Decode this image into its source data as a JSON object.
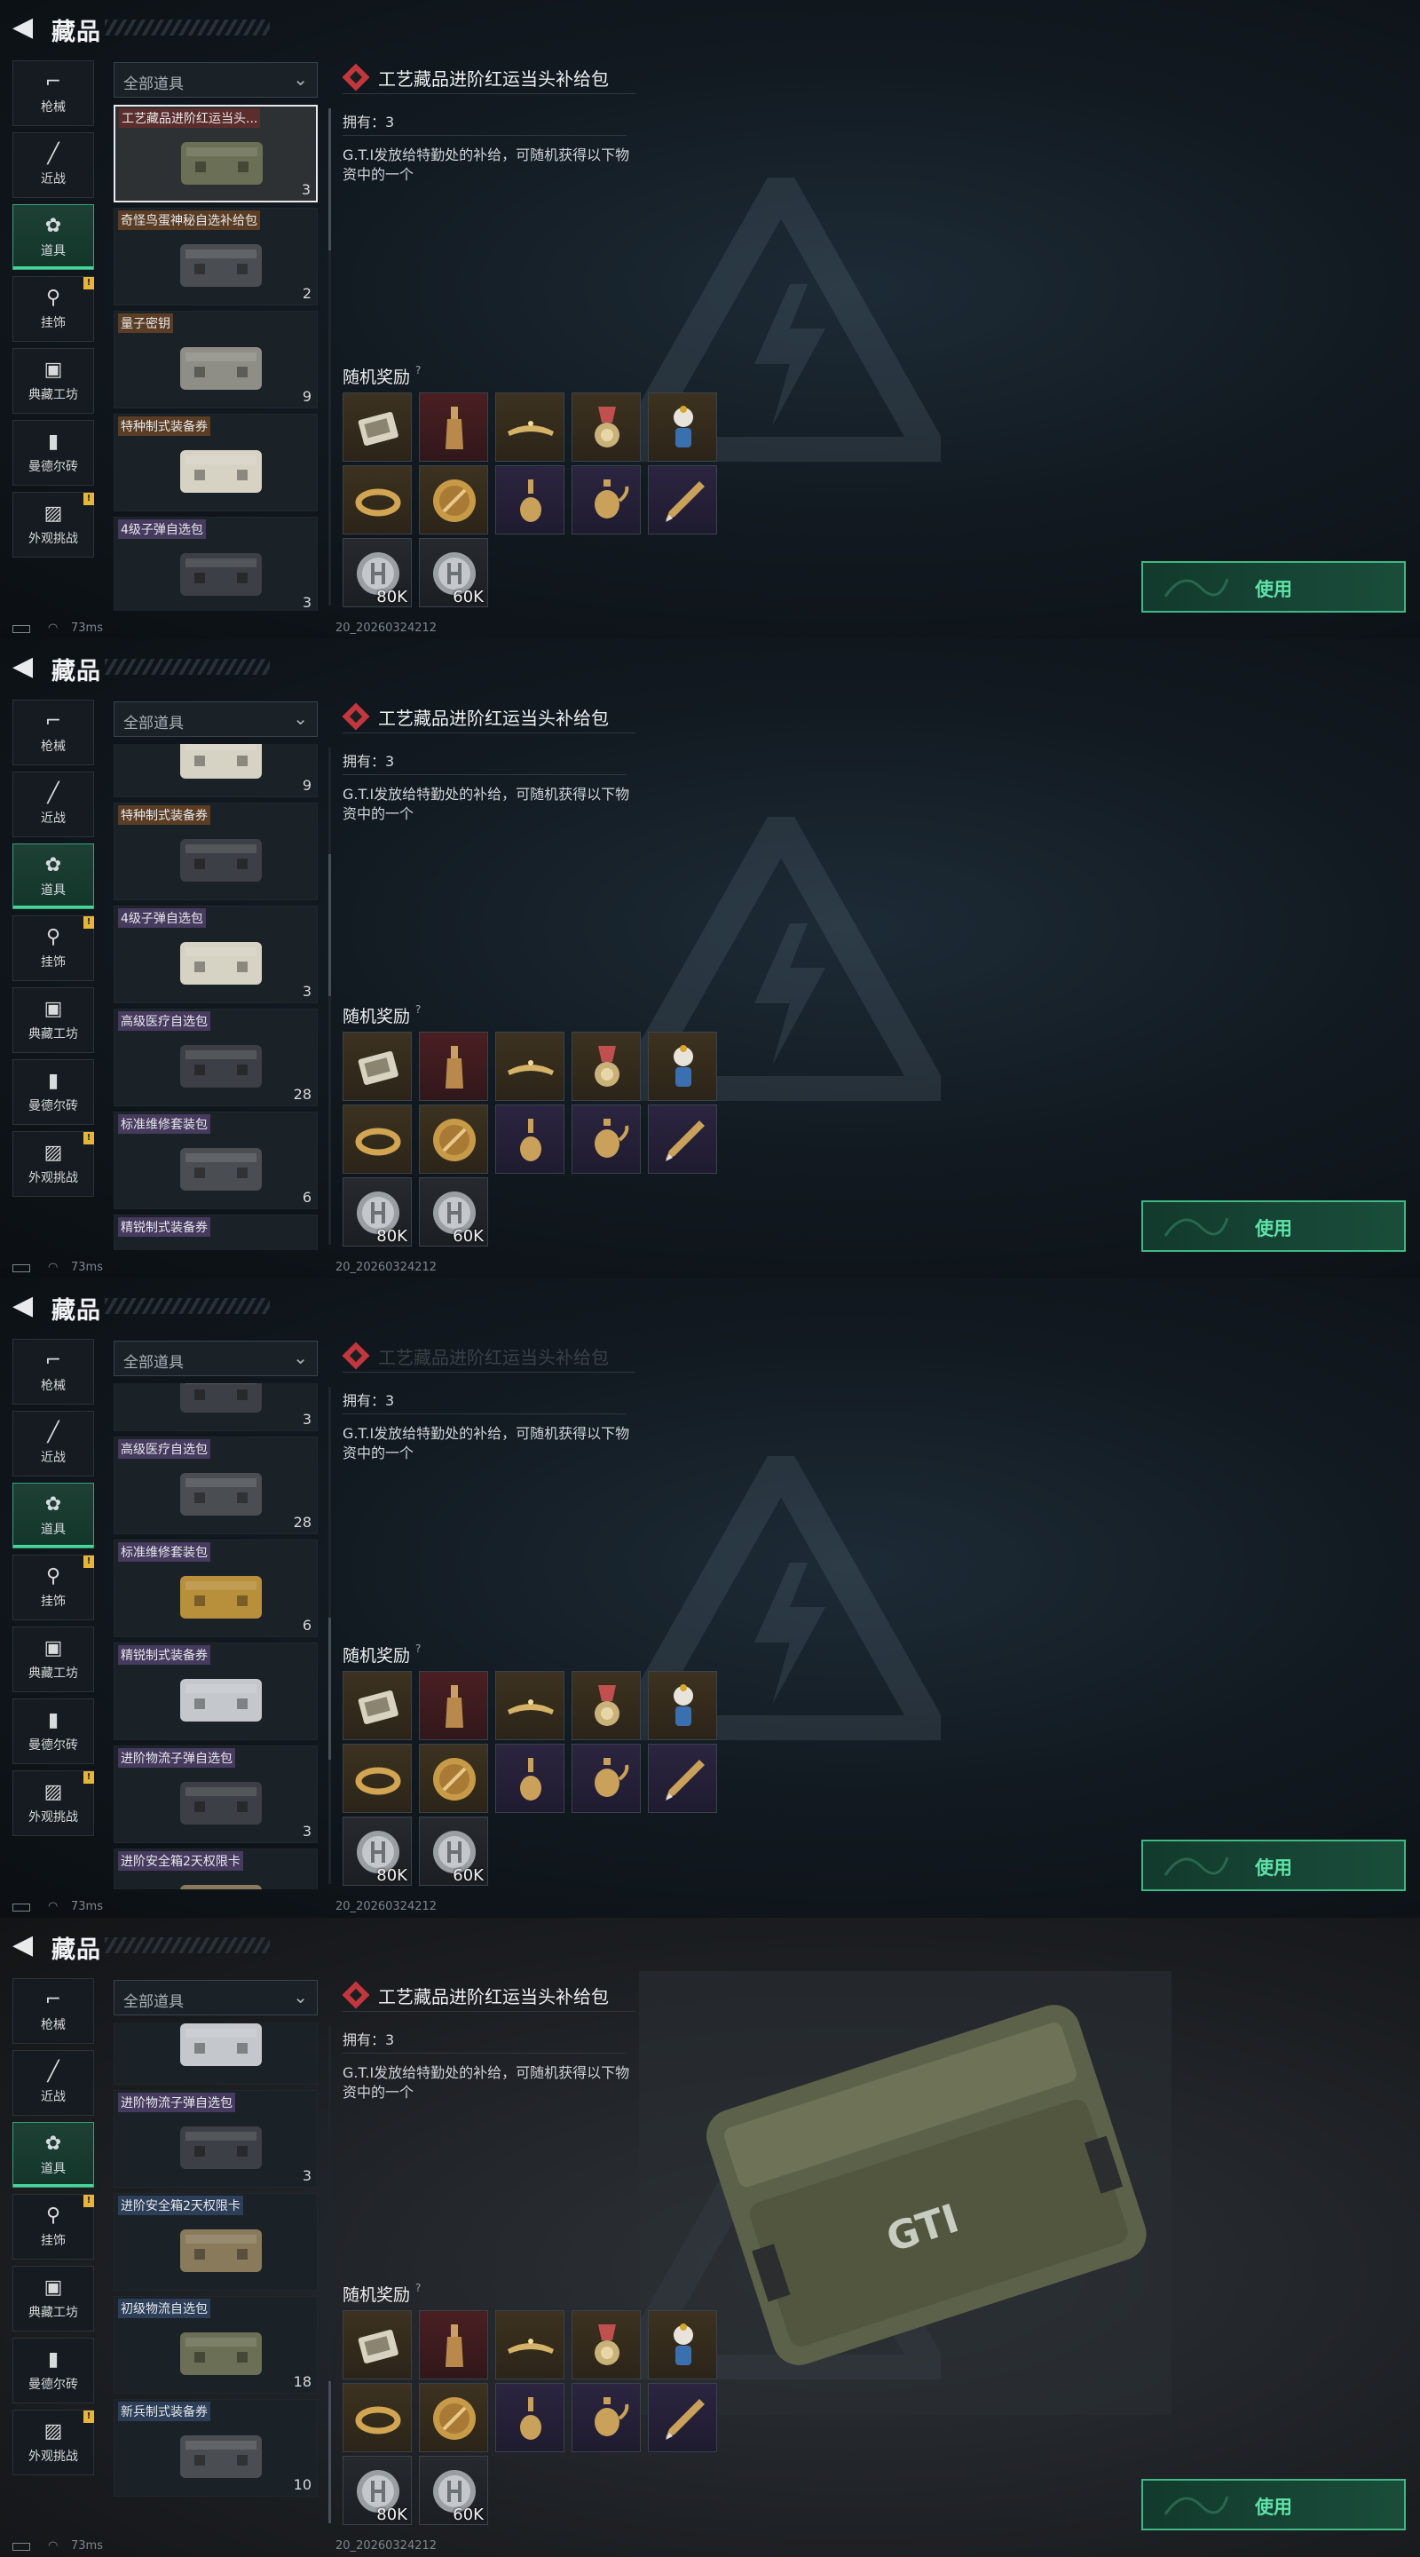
{
  "header": {
    "title": "藏品",
    "back_icon": "back-arrow-icon"
  },
  "categories": [
    {
      "label": "枪械",
      "icon": "gun-icon",
      "badge": ""
    },
    {
      "label": "近战",
      "icon": "knife-icon",
      "badge": ""
    },
    {
      "label": "道具",
      "icon": "items-icon",
      "badge": "",
      "active": true
    },
    {
      "label": "挂饰",
      "icon": "charm-icon",
      "badge": "!"
    },
    {
      "label": "典藏工坊",
      "icon": "workshop-icon",
      "badge": ""
    },
    {
      "label": "曼德尔砖",
      "icon": "mandel-brick-icon",
      "badge": ""
    },
    {
      "label": "外观挑战",
      "icon": "challenge-icon",
      "badge": "!"
    }
  ],
  "filter": {
    "label": "全部道具",
    "icon": "chevron-down-icon"
  },
  "screens": [
    {
      "items": [
        {
          "name": "工艺藏品进阶红运当头...",
          "qty": "3",
          "color": "red",
          "selected": true
        },
        {
          "name": "奇怪鸟蛋神秘自选补给包",
          "qty": "2",
          "color": "org"
        },
        {
          "name": "量子密钥",
          "qty": "9",
          "color": "org"
        },
        {
          "name": "特种制式装备券",
          "qty": "",
          "color": "org"
        },
        {
          "name": "4级子弹自选包",
          "qty": "3",
          "color": "pur"
        }
      ]
    },
    {
      "items": [
        {
          "name": "",
          "qty": "9",
          "color": ""
        },
        {
          "name": "特种制式装备券",
          "qty": "",
          "color": "org"
        },
        {
          "name": "4级子弹自选包",
          "qty": "3",
          "color": "pur"
        },
        {
          "name": "高级医疗自选包",
          "qty": "28",
          "color": "pur"
        },
        {
          "name": "标准维修套装包",
          "qty": "6",
          "color": "pur"
        },
        {
          "name": "精锐制式装备券",
          "qty": "",
          "color": "pur"
        }
      ]
    },
    {
      "items": [
        {
          "name": "",
          "qty": "3",
          "color": ""
        },
        {
          "name": "高级医疗自选包",
          "qty": "28",
          "color": "pur"
        },
        {
          "name": "标准维修套装包",
          "qty": "6",
          "color": "pur"
        },
        {
          "name": "精锐制式装备券",
          "qty": "",
          "color": "pur"
        },
        {
          "name": "进阶物流子弹自选包",
          "qty": "3",
          "color": "pur"
        },
        {
          "name": "进阶安全箱2天权限卡",
          "qty": "",
          "color": "pur"
        }
      ]
    },
    {
      "items": [
        {
          "name": "",
          "qty": "",
          "color": ""
        },
        {
          "name": "进阶物流子弹自选包",
          "qty": "3",
          "color": "pur"
        },
        {
          "name": "进阶安全箱2天权限卡",
          "qty": "",
          "color": "blu"
        },
        {
          "name": "初级物流自选包",
          "qty": "18",
          "color": "blu"
        },
        {
          "name": "新兵制式装备券",
          "qty": "10",
          "color": "blu"
        }
      ]
    }
  ],
  "detail": {
    "title": "工艺藏品进阶红运当头补给包",
    "title_cut": "工艺藏品进阶红运当头补给包",
    "owned": "拥有：3",
    "description": "G.T.I发放给特勤处的补给，可随机获得以下物资中的一个",
    "rewards_title": "随机奖励",
    "rewards_help": "?"
  },
  "rewards": [
    {
      "icon": "book-icon",
      "bg": "gold",
      "qty": ""
    },
    {
      "icon": "bottle-icon",
      "bg": "red",
      "qty": ""
    },
    {
      "icon": "tiara-icon",
      "bg": "gold",
      "qty": ""
    },
    {
      "icon": "medal-icon",
      "bg": "gold",
      "qty": ""
    },
    {
      "icon": "figurine-icon",
      "bg": "gold",
      "qty": ""
    },
    {
      "icon": "bracelet-icon",
      "bg": "gold",
      "qty": ""
    },
    {
      "icon": "gold-plate-icon",
      "bg": "gold",
      "qty": ""
    },
    {
      "icon": "vase-icon",
      "bg": "purple",
      "qty": ""
    },
    {
      "icon": "teapot-icon",
      "bg": "purple",
      "qty": ""
    },
    {
      "icon": "pen-icon",
      "bg": "purple",
      "qty": ""
    },
    {
      "icon": "coin-icon",
      "bg": "grey",
      "qty": "80K"
    },
    {
      "icon": "coin-icon",
      "bg": "grey",
      "qty": "60K"
    }
  ],
  "use_button": "使用",
  "status": {
    "ping": "73ms",
    "version": "20_20260324212"
  },
  "colors": {
    "accent_green": "#3fb885",
    "badge_yellow": "#e6b53c",
    "title_red": "#c2363d"
  }
}
